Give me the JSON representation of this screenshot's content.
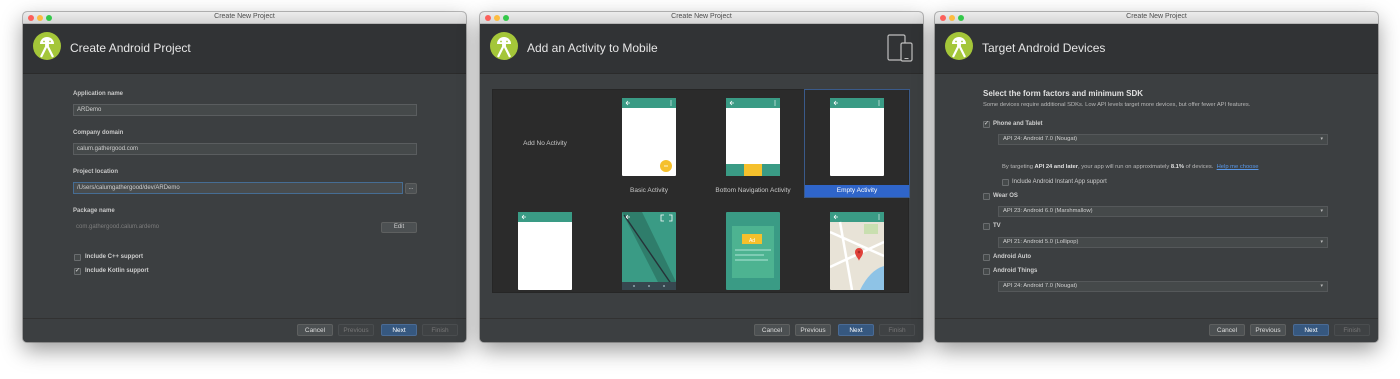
{
  "window_title": "Create New Project",
  "colors": {
    "android_green": "#a4c639",
    "accent_blue": "#2f65ca",
    "primary_button": "#365880",
    "dark_bg": "#3c3f41"
  },
  "step1": {
    "header_title": "Create Android Project",
    "application_name_label": "Application name",
    "application_name_value": "ARDemo",
    "company_domain_label": "Company domain",
    "company_domain_value": "calum.gathergood.com",
    "project_location_label": "Project location",
    "project_location_value": "/Users/calumgathergood/dev/ARDemo",
    "browse_label": "...",
    "package_name_label": "Package name",
    "package_name_value": "com.gathergood.calum.ardemo",
    "edit_label": "Edit",
    "cpp_support_label": "Include C++ support",
    "cpp_support_checked": false,
    "kotlin_support_label": "Include Kotlin support",
    "kotlin_support_checked": true
  },
  "step2": {
    "header_title": "Add an Activity to Mobile",
    "no_activity_label": "Add No Activity",
    "basic_activity_label": "Basic Activity",
    "bottom_nav_label": "Bottom Navigation Activity",
    "empty_activity_label": "Empty Activity",
    "selected": "Empty Activity",
    "ad_label": "Ad"
  },
  "step3": {
    "header_title": "Target Android Devices",
    "title": "Select the form factors and minimum SDK",
    "subtitle": "Some devices require additional SDKs. Low API levels target more devices, but offer fewer API features.",
    "phone_label": "Phone and Tablet",
    "phone_checked": true,
    "phone_api": "API 24: Android 7.0 (Nougat)",
    "note_prefix": "By targeting ",
    "note_bold1": "API 24 and later",
    "note_mid": ", your app will run on approximately ",
    "note_bold2": "8.1%",
    "note_suffix": " of devices.",
    "help_link": "Help me choose",
    "instant_app_label": "Include Android Instant App support",
    "wear_label": "Wear OS",
    "wear_api": "API 23: Android 6.0 (Marshmallow)",
    "tv_label": "TV",
    "tv_api": "API 21: Android 5.0 (Lollipop)",
    "auto_label": "Android Auto",
    "things_label": "Android Things",
    "things_api": "API 24: Android 7.0 (Nougat)"
  },
  "footer": {
    "cancel": "Cancel",
    "previous": "Previous",
    "next": "Next",
    "finish": "Finish"
  },
  "icons": {
    "logo": "android-studio-logo-icon",
    "devices": "phone-tablet-icon",
    "check": "✓",
    "dropdown": "▾"
  }
}
